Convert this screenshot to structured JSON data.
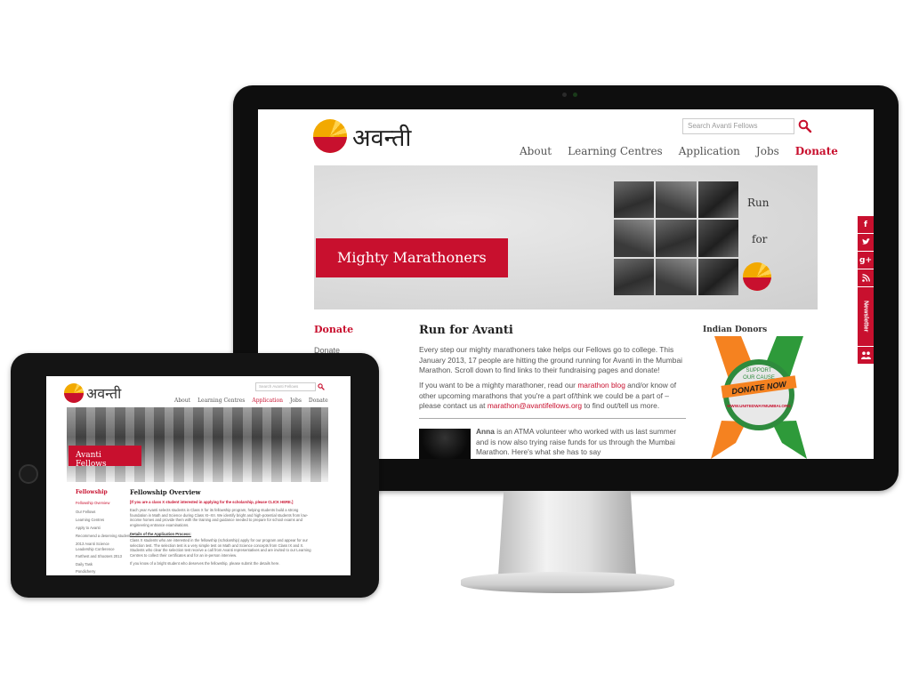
{
  "monitor": {
    "logo_text": "अवन्ती",
    "search_placeholder": "Search Avanti Fellows",
    "nav": [
      "About",
      "Learning Centres",
      "Application",
      "Jobs",
      "Donate"
    ],
    "banner_label": "Mighty Marathoners",
    "banner_run": "Run",
    "banner_for": "for",
    "sidebar_title": "Donate",
    "sidebar_items": [
      "Donate"
    ],
    "heading": "Run for Avanti",
    "para1": "Every step our mighty marathoners take helps our Fellows go to college. This January 2013, 17 people are hitting the ground running for Avanti in the Mumbai Marathon. Scroll down to find links to their fundraising pages and donate!",
    "para2_a": "If you want to be a mighty marathoner, read our ",
    "para2_link": "marathon blog",
    "para2_b": " and/or know of other upcoming marathons that you're a part of/think we could be a part of – please contact us at ",
    "para2_email": "marathon@avantifellows.org",
    "para2_c": " to find out/tell us more.",
    "anna_name": "Anna",
    "anna_text": " is an ATMA volunteer who worked with us last summer and is now also trying raise funds for us through the Mumbai Marathon. Here's what she has to say",
    "donors_title": "Indian Donors",
    "badge_support": "SUPPORT",
    "badge_cause": "OUR CAUSE",
    "badge_donate": "DONATE NOW",
    "badge_url": "WWW.UNITEDWAYMUMBAI.ORG",
    "social": [
      "f",
      "t",
      "g+",
      "rss"
    ],
    "newsletter": "Newsletter"
  },
  "tablet": {
    "logo_text": "अवन्ती",
    "search_placeholder": "Search Avanti Fellows",
    "nav": [
      "About",
      "Learning Centres",
      "Application",
      "Jobs",
      "Donate"
    ],
    "banner_label": "Avanti Fellows",
    "sidebar_title": "Fellowship",
    "sidebar_items": [
      "Fellowship Overview",
      "Our Fellows",
      "Learning Centres",
      "Apply to Avanti",
      "Recommend a deserving student",
      "2013 Avanti Science Leadership Conference",
      "Farthest and Shooters 2013",
      "Daily Task",
      "Pondicherry"
    ],
    "heading": "Fellowship Overview",
    "note": "[If you are a class X student interested in applying for the scholarship, please CLICK HERE.]",
    "body1": "Each year Avanti selects students in Class X for its fellowship program, helping students build a strong foundation in Math and Science during Class XI–XII. We identify bright and high-potential students from low-income homes and provide them with the training and guidance needed to prepare for school exams and engineering entrance examinations.",
    "sub": "Details of the Application Process:",
    "body2": "Class X students who are interested in the fellowship (scholarship) apply for our program and appear for our selection test. The selection test is a very simple test on Math and Science concepts from Class IX and X. Students who clear the selection test receive a call from Avanti representatives and are invited to our Learning Centres to collect their certificates and for an in-person interview.",
    "body3": "If you know of a bright student who deserves the fellowship, please submit the details here."
  },
  "colors": {
    "accent": "#c8102e",
    "sun": "#f2a900"
  }
}
